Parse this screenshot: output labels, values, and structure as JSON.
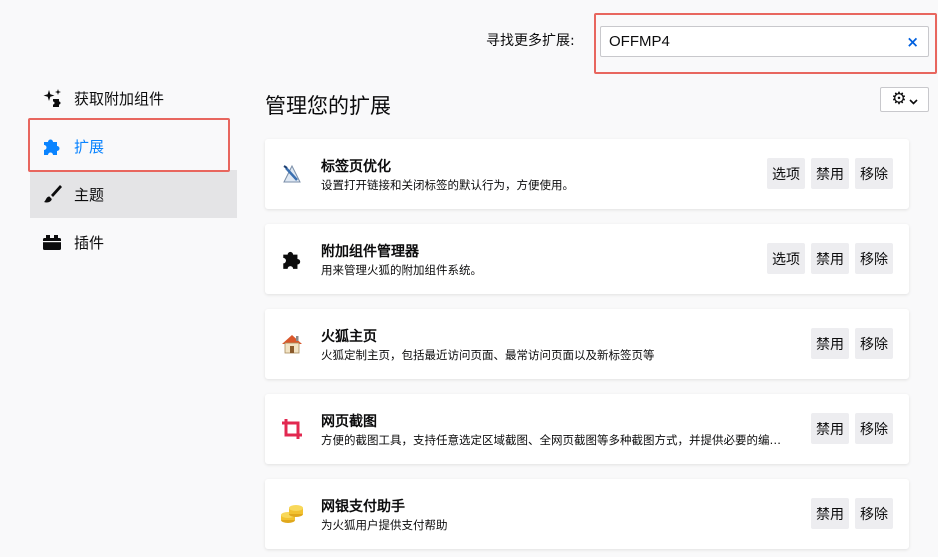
{
  "search": {
    "label": "寻找更多扩展:",
    "value": "OFFMP4",
    "clear_glyph": "×"
  },
  "sidebar": {
    "items": [
      {
        "label": "获取附加组件",
        "icon": "sparkle-puzzle-icon"
      },
      {
        "label": "扩展",
        "icon": "puzzle-icon",
        "selected": true
      },
      {
        "label": "主题",
        "icon": "brush-icon"
      },
      {
        "label": "插件",
        "icon": "plugin-block-icon"
      }
    ]
  },
  "main": {
    "title": "管理您的扩展",
    "gear_glyph": "⚙",
    "chevron_glyph": "⌄"
  },
  "colors": {
    "accent": "#0a84ff",
    "highlight_border": "#e8665e",
    "tab_icon_red": "#e22850"
  },
  "extensions": [
    {
      "name": "标签页优化",
      "desc": "设置打开链接和关闭标签的默认行为，方便使用。",
      "icon": "tab-pen-icon",
      "buttons": [
        "选项",
        "禁用",
        "移除"
      ]
    },
    {
      "name": "附加组件管理器",
      "desc": "用来管理火狐的附加组件系统。",
      "icon": "puzzle-black-icon",
      "buttons": [
        "选项",
        "禁用",
        "移除"
      ]
    },
    {
      "name": "火狐主页",
      "desc": "火狐定制主页，包括最近访问页面、最常访问页面以及新标签页等",
      "icon": "house-icon",
      "buttons": [
        "禁用",
        "移除"
      ]
    },
    {
      "name": "网页截图",
      "desc": "方便的截图工具，支持任意选定区域截图、全网页截图等多种截图方式，并提供必要的编辑功能",
      "icon": "crop-icon",
      "buttons": [
        "禁用",
        "移除"
      ]
    },
    {
      "name": "网银支付助手",
      "desc": "为火狐用户提供支付帮助",
      "icon": "coins-icon",
      "buttons": [
        "禁用",
        "移除"
      ]
    }
  ]
}
